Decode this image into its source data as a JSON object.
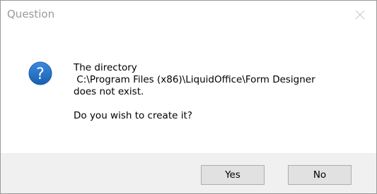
{
  "window": {
    "title": "Question",
    "close_icon": "close-icon"
  },
  "message": {
    "icon": "question-icon",
    "icon_glyph": "?",
    "line1": "The directory",
    "line2": " C:\\Program Files (x86)\\LiquidOffice\\Form Designer",
    "line3": "does not exist.",
    "line4": "Do you wish to create it?"
  },
  "buttons": {
    "yes_label": "Yes",
    "no_label": "No"
  },
  "colors": {
    "title_text": "#9a9a9a",
    "icon_blue": "#1f6fc2",
    "button_bar": "#f0f0f0",
    "button_face": "#e1e1e1",
    "button_border": "#adadad"
  }
}
